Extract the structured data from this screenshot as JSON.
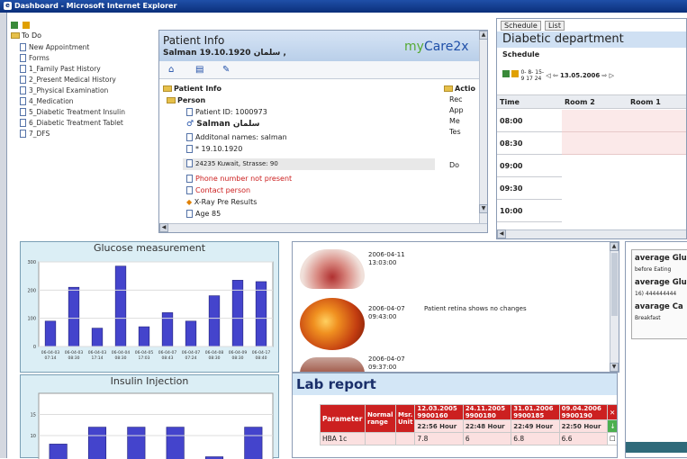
{
  "window": {
    "title": "Dashboard - Microsoft Internet Explorer"
  },
  "todo": {
    "root": "To Do",
    "items": [
      "New Appointment",
      "Forms",
      "1_Family Past History",
      "2_Present Medical History",
      "3_Physical Examination",
      "4_Medication",
      "5_Diabetic Treatment Insulin",
      "6_Diabetic Treatment Tablet",
      "7_DFS"
    ]
  },
  "patient": {
    "header": "Patient Info",
    "name_line": "Salman 19.10.1920",
    "name_arabic": "سلمان ,",
    "brand_my": "my",
    "brand_care": "Care2x",
    "tree_root": "Patient Info",
    "person": "Person",
    "id_line": "Patient ID: 1000973",
    "salman": "Salman",
    "salman_ar": "سلمان",
    "additional": "Additonal names: salman",
    "dob": "* 19.10.1920",
    "address": "24235 Kuwait, Strasse: 90",
    "phone": "Phone number not present",
    "contact": "Contact person",
    "xray": "X-Ray Pre Results",
    "age": "Age 85",
    "actions_title": "Actio",
    "actions": [
      "Rec",
      "App",
      "Me",
      "Tes",
      "Do"
    ]
  },
  "schedule": {
    "tab_schedule": "Schedule",
    "tab_list": "List",
    "department": "Diabetic department",
    "sub_title": "Schedule",
    "intervals_top": "0-  8-  15-",
    "intervals_bottom": "9   17  24",
    "date": "13.05.2006",
    "col_time": "Time",
    "col_room2": "Room 2",
    "col_room1": "Room 1",
    "times": [
      "08:00",
      "08:30",
      "09:00",
      "09:30",
      "10:00"
    ]
  },
  "glucose": {
    "title": "Glucose measurement",
    "chart_data": {
      "type": "bar",
      "title": "Glucose measurement",
      "ylim": [
        0,
        300
      ],
      "yticks": [
        "0",
        "100",
        "200",
        "300"
      ],
      "categories": [
        "06-04-03 07:14",
        "06-04-03 08:30",
        "06-04-03 17:14",
        "06-04-04 08:30",
        "06-04-05 17:03",
        "06-04-07 08:43",
        "06-04-07 07:24",
        "06-04-08 08:30",
        "06-04-09 08:30",
        "06-04-17 08:40"
      ],
      "values": [
        90,
        210,
        65,
        285,
        70,
        120,
        90,
        180,
        235,
        230
      ]
    }
  },
  "insulin": {
    "title": "Insulin Injection",
    "chart_data": {
      "type": "bar",
      "title": "Insulin Injection",
      "yticks": [
        "10",
        "15"
      ],
      "values": [
        8,
        12,
        12,
        12,
        5,
        12
      ]
    }
  },
  "images": {
    "entries": [
      {
        "date": "2006-04-11",
        "time": "13:03:00",
        "note": ""
      },
      {
        "date": "2006-04-07",
        "time": "09:43:00",
        "note": "Patient retina shows no changes"
      },
      {
        "date": "2006-04-07",
        "time": "09:37:00",
        "note": ""
      }
    ]
  },
  "lab": {
    "title": "Lab report",
    "headers": {
      "param": "Parameter",
      "normal": "Normal range",
      "msr": "Msr. Unit"
    },
    "dates": [
      "12.03.2005 9900160",
      "24.11.2005 9900180",
      "31.01.2006 9900185",
      "09.04.2006 9900190"
    ],
    "times": [
      "22:56 Hour",
      "22:48 Hour",
      "22:49 Hour",
      "22:50 Hour"
    ],
    "rows": [
      {
        "param": "HBA 1c",
        "values": [
          "7.8",
          "6",
          "6.8",
          "6.6"
        ]
      }
    ]
  },
  "averages": {
    "items": [
      "average Glu",
      "before Eating",
      "average Glu",
      "16) 444444444",
      "avarage Ca",
      "Breakfast"
    ]
  },
  "colors": {
    "titlebar": "#0b2f7a",
    "accent": "#cc2020",
    "chart_bg": "#dbeef5",
    "bar": "#4444cc"
  }
}
